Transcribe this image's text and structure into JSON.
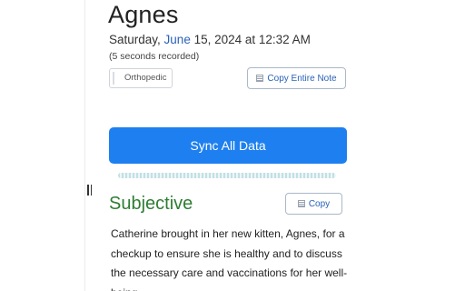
{
  "patient": {
    "name": "Agnes",
    "date_prefix": "Saturday, ",
    "date_month": "June",
    "date_suffix": " 15, 2024 at 12:32 AM",
    "recorded": "(5 seconds recorded)",
    "tag": "Orthopedic"
  },
  "actions": {
    "copy_entire_note": "Copy Entire Note",
    "sync_all_data": "Sync All Data",
    "copy": "Copy"
  },
  "subjective": {
    "title": "Subjective",
    "text": "Catherine brought in her new kitten, Agnes, for a checkup to ensure she is healthy and to discuss the necessary care and vaccinations for her well-being."
  },
  "colors": {
    "accent_blue": "#1e80f0",
    "link_blue": "#2a62b8",
    "section_green": "#2e7d32"
  },
  "icons": {
    "copy": "document-icon",
    "resize": "drag-handle-icon"
  }
}
